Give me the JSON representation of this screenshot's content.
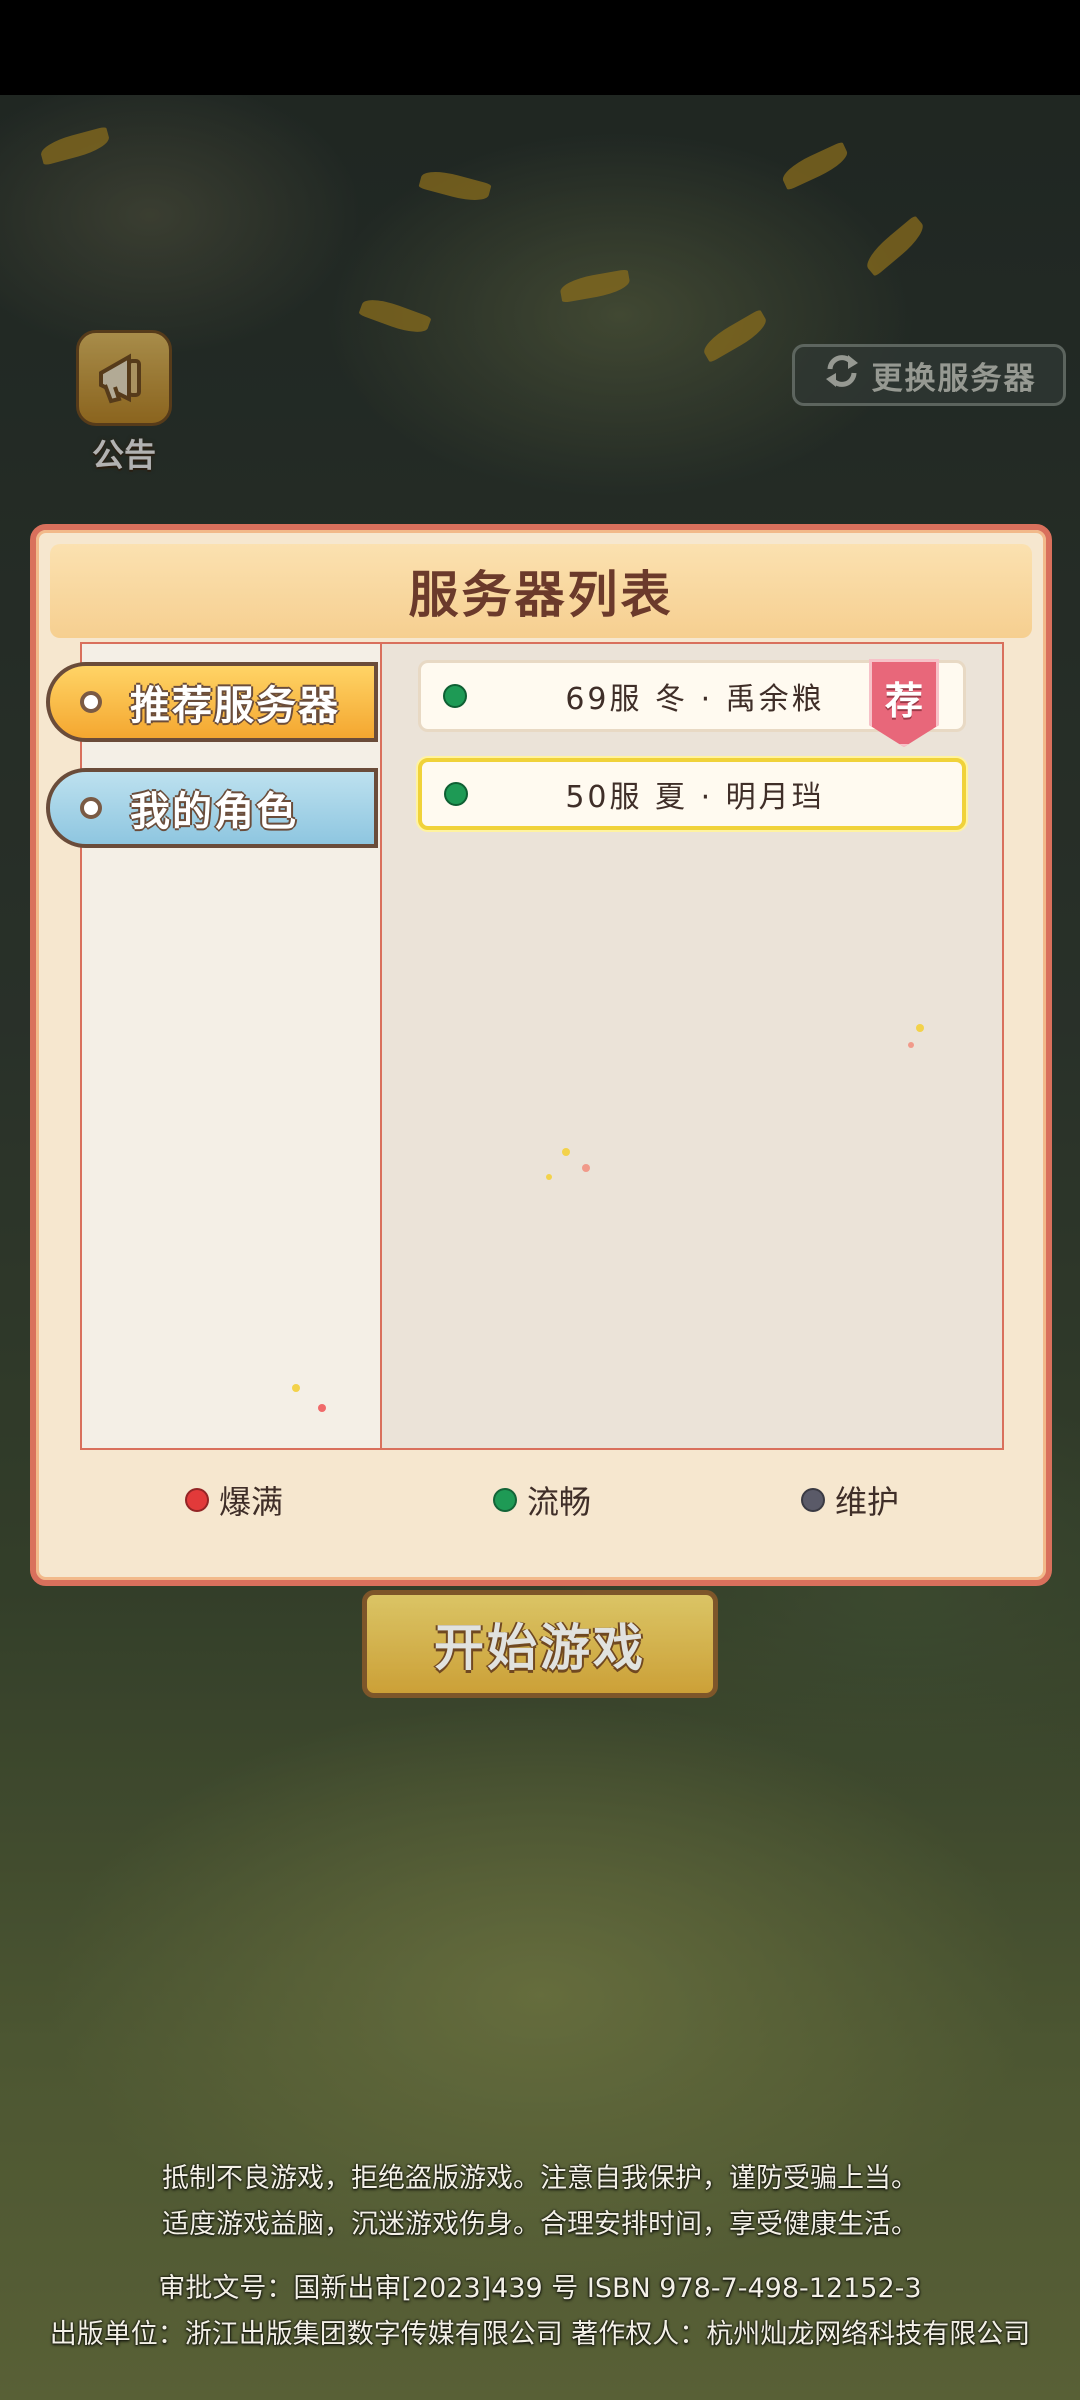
{
  "announcement": {
    "label": "公告"
  },
  "switch_server": {
    "label": "更换服务器"
  },
  "server_list": {
    "title": "服务器列表",
    "tabs": [
      {
        "label": "推荐服务器",
        "active": true
      },
      {
        "label": "我的角色",
        "active": false
      }
    ],
    "servers": [
      {
        "name": "69服 冬 · 禹余粮",
        "status": "流畅",
        "badge": "荐",
        "selected": false
      },
      {
        "name": "50服 夏 · 明月珰",
        "status": "流畅",
        "selected": true
      }
    ],
    "legend": [
      {
        "label": "爆满",
        "color": "#e23a3a"
      },
      {
        "label": "流畅",
        "color": "#1e9a55"
      },
      {
        "label": "维护",
        "color": "#5a5a68"
      }
    ]
  },
  "start_button": {
    "label": "开始游戏"
  },
  "footer": {
    "line1": "抵制不良游戏，拒绝盗版游戏。注意自我保护，谨防受骗上当。",
    "line2": "适度游戏益脑，沉迷游戏伤身。合理安排时间，享受健康生活。",
    "line3": "审批文号：国新出审[2023]439 号  ISBN 978-7-498-12152-3",
    "line4": "出版单位：浙江出版集团数字传媒有限公司  著作权人：杭州灿龙网络科技有限公司"
  }
}
